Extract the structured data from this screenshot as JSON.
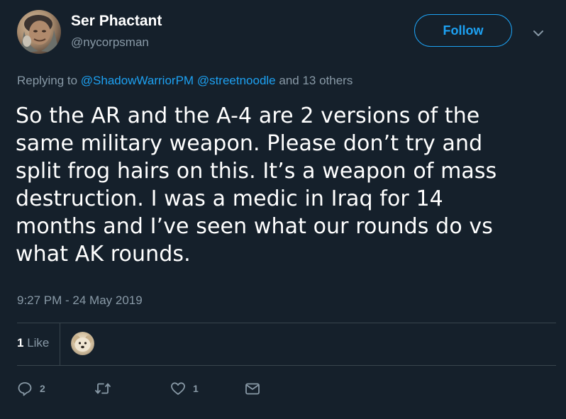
{
  "author": {
    "display_name": "Ser Phactant",
    "handle": "@nycorpsman"
  },
  "header": {
    "follow_label": "Follow"
  },
  "reply": {
    "prefix": "Replying to",
    "mention_1": "@ShadowWarriorPM",
    "mention_2": "@streetnoodle",
    "suffix": "and 13 others"
  },
  "tweet": {
    "lines": [
      "So the AR and the A-4 are 2 versions of the",
      "same military weapon. Please don’t try and",
      "split frog hairs on this. It’s a weapon of mass",
      "destruction. I was a medic in Iraq for 14",
      "months and I’ve seen what our rounds do vs",
      "what AK rounds."
    ],
    "timestamp": "9:27 PM - 24 May 2019"
  },
  "stats": {
    "likes_number": "1",
    "likes_label": "Like"
  },
  "actions": {
    "reply_count": "2",
    "like_count": "1"
  },
  "colors": {
    "background": "#15202b",
    "accent": "#1da1f2",
    "muted": "#8899a6",
    "divider": "#38444d"
  },
  "icons": {
    "reply": "speech-bubble-icon",
    "retweet": "retweet-icon",
    "like": "heart-icon",
    "dm": "envelope-icon",
    "caret": "chevron-down-icon"
  }
}
